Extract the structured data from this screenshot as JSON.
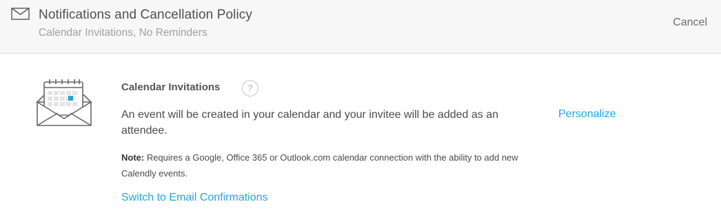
{
  "header": {
    "title": "Notifications and Cancellation Policy",
    "subtitle": "Calendar Invitations, No Reminders",
    "cancel_label": "Cancel",
    "icon": "envelope-icon"
  },
  "option": {
    "icon": "calendar-invitation-icon",
    "title": "Calendar Invitations",
    "help_glyph": "?",
    "description": "An event will be created in your calendar and your invitee will be added as an attendee.",
    "note_label": "Note:",
    "note_text": " Requires a Google, Office 365 or Outlook.com calendar connection with the ability to add new Calendly events.",
    "personalize_label": "Personalize",
    "switch_label": "Switch to Email Confirmations"
  },
  "colors": {
    "link": "#1ea7e1",
    "header_bg": "#f7f7f7",
    "text": "#4a4a4a"
  }
}
